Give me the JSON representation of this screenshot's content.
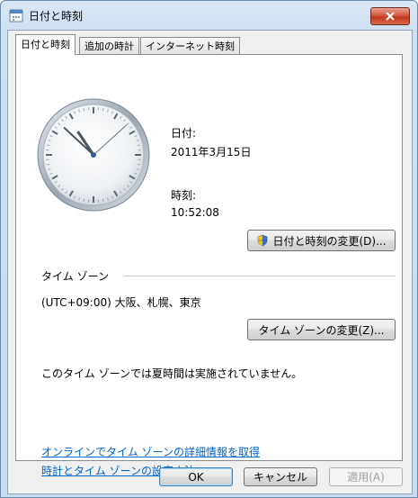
{
  "window": {
    "title": "日付と時刻"
  },
  "tabs": [
    {
      "label": "日付と時刻"
    },
    {
      "label": "追加の時計"
    },
    {
      "label": "インターネット時刻"
    }
  ],
  "datetime": {
    "date_label": "日付:",
    "date_value": "2011年3月15日",
    "time_label": "時刻:",
    "time_value": "10:52:08",
    "change_button": "日付と時刻の変更(D)..."
  },
  "timezone": {
    "section_label": "タイム ゾーン",
    "value": "(UTC+09:00) 大阪、札幌、東京",
    "change_button": "タイム ゾーンの変更(Z)...",
    "dst_note": "このタイム ゾーンでは夏時間は実施されていません。"
  },
  "links": [
    {
      "label": "オンラインでタイム ゾーンの詳細情報を取得"
    },
    {
      "label": "時計とタイム ゾーンの設定方法"
    }
  ],
  "footer": {
    "ok": "OK",
    "cancel": "キャンセル",
    "apply": "適用(A)"
  },
  "clock": {
    "hour": 10,
    "minute": 52,
    "second": 8
  }
}
